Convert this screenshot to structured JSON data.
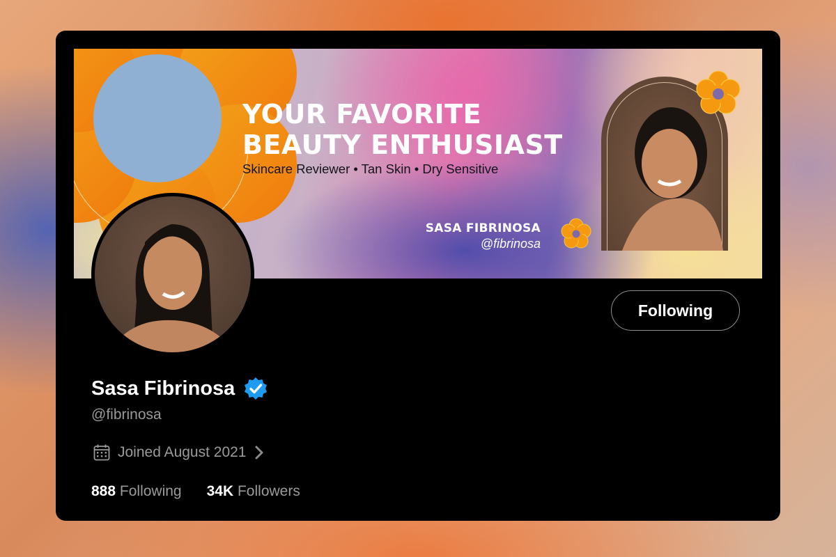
{
  "banner": {
    "headline_line1": "YOUR FAVORITE",
    "headline_line2": "BEAUTY ENTHUSIAST",
    "tagline": "Skincare Reviewer • Tan Skin • Dry Sensitive",
    "name": "SASA FIBRINOSA",
    "handle": "@fibrinosa"
  },
  "profile": {
    "display_name": "Sasa Fibrinosa",
    "handle": "@fibrinosa",
    "joined": "Joined August 2021",
    "follow_button": "Following",
    "verified": true
  },
  "stats": [
    {
      "count": "888",
      "label": "Following"
    },
    {
      "count": "34K",
      "label": "Followers"
    }
  ],
  "colors": {
    "accent": "#1d9bf0",
    "flower_orange": "#f59a10",
    "flower_center": "#7e6aa8",
    "card_bg": "#000000"
  },
  "icons": {
    "verified": "verified-badge-icon",
    "calendar": "calendar-icon",
    "chevron": "chevron-right-icon",
    "flower": "flower-icon"
  }
}
